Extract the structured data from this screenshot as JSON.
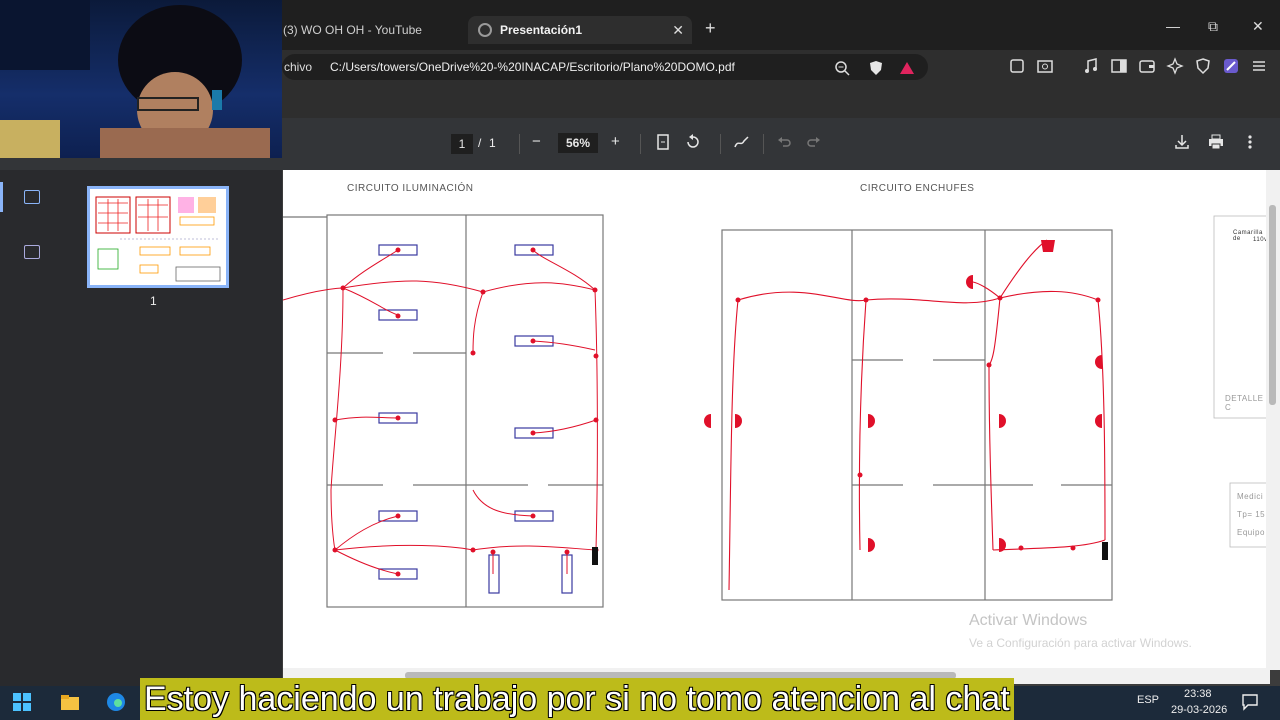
{
  "browser": {
    "tabs": [
      {
        "label": "(3) WO OH OH - YouTube"
      },
      {
        "label": "Presentación1",
        "close": "✕"
      }
    ],
    "new_tab": "+",
    "window_controls": {
      "minimize": "—",
      "maximize": "⧉",
      "close": "✕"
    },
    "address": {
      "prefix": "chivo",
      "url": "C:/Users/towers/OneDrive%20-%20INACAP/Escritorio/Plano%20DOMO.pdf"
    }
  },
  "pdf_toolbar": {
    "page_current": "1",
    "page_sep": "/",
    "page_total": "1",
    "zoom_out": "−",
    "zoom": "56%",
    "zoom_in": "+"
  },
  "sidebar": {
    "thumb_number": "1"
  },
  "plan": {
    "title_left": "CIRCUITO ILUMINACIÓN",
    "title_right": "CIRCUITO ENCHUFES",
    "side_labels": [
      "Medici",
      "Tp= 15",
      "Equipo"
    ],
    "detail_label": "DETALLE C",
    "detail_header": "Camarilla de",
    "detail_sub": "110v"
  },
  "watermark": {
    "line1": "Activar Windows",
    "line2": "Ve a Configuración para activar Windows."
  },
  "taskbar": {
    "lang": "ESP",
    "time": "23:38",
    "date": "29-03-2026"
  },
  "subtitle": "Estoy haciendo un trabajo por si no tomo atencion al chat",
  "colors": {
    "accent": "#8ab4f8",
    "wire": "#e0102a",
    "fixture": "#3a3aa0"
  }
}
